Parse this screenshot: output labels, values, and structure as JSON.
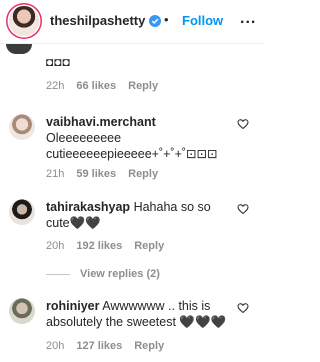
{
  "header": {
    "username": "theshilpashetty",
    "separator": "•",
    "follow_label": "Follow",
    "more_label": "..."
  },
  "previous_comment": {
    "text_fragment": "◘◘◘",
    "time": "22h",
    "likes": "66 likes",
    "reply_label": "Reply"
  },
  "comments": [
    {
      "username": "vaibhavi.merchant",
      "text": "Oleeeeeeeee cutieeeeeepieeeee+˚+˚+˚⊡⊡⊡",
      "time": "21h",
      "likes": "59 likes",
      "reply_label": "Reply"
    },
    {
      "username": "tahirakashyap",
      "text": "Hahaha so so cute🖤🖤",
      "time": "20h",
      "likes": "192 likes",
      "reply_label": "Reply",
      "view_replies": "View replies (2)"
    },
    {
      "username": "rohiniyer",
      "text": "Awwwwww .. this is absolutely the sweetest 🖤🖤🖤",
      "time": "20h",
      "likes": "127 likes",
      "reply_label": "Reply"
    }
  ],
  "colors": {
    "link_blue": "#0095f6",
    "meta_gray": "#8e8e8e",
    "text_dark": "#262626"
  },
  "icons": [
    "verified-badge-icon",
    "heart-outline-icon",
    "more-options-icon"
  ]
}
